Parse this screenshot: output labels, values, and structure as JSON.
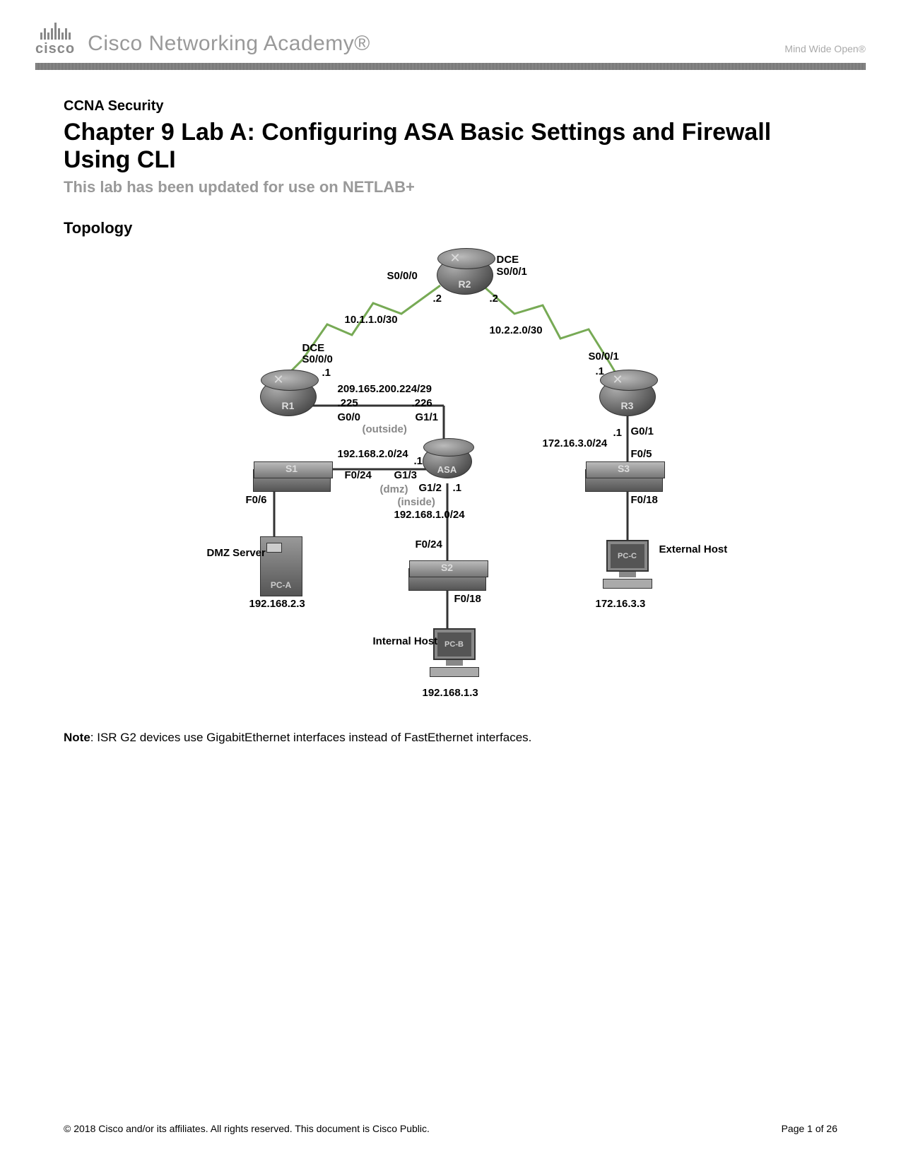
{
  "header": {
    "logo_text": "cisco",
    "academy": "Cisco Networking Academy®",
    "tagline": "Mind Wide Open®"
  },
  "course": "CCNA Security",
  "title": "Chapter 9 Lab A: Configuring ASA Basic Settings and Firewall Using CLI",
  "updated": "This lab has been updated for use on NETLAB+",
  "section": "Topology",
  "topology": {
    "devices": {
      "R1": "R1",
      "R2": "R2",
      "R3": "R3",
      "S1": "S1",
      "S2": "S2",
      "S3": "S3",
      "ASA": "ASA",
      "PCA": "PC-A",
      "PCB": "PC-B",
      "PCC": "PC-C"
    },
    "labels": {
      "dce1": "DCE",
      "r2_s000": "S0/0/0",
      "r2_s001": "S0/0/1",
      "r2_dot2a": ".2",
      "r2_dot2b": ".2",
      "net_10_1": "10.1.1.0/30",
      "net_10_2": "10.2.2.0/30",
      "r1_dce": "DCE",
      "r1_s000": "S0/0/0",
      "r1_dot1": ".1",
      "r3_s001": "S0/0/1",
      "r3_dot1": ".1",
      "net_209": "209.165.200.224/29",
      "dot225": ".225",
      "dot226": ".226",
      "g00": "G0/0",
      "g11": "G1/1",
      "outside": "(outside)",
      "net_172": "172.16.3.0/24",
      "r3_g01": "G0/1",
      "r3_dot1b": ".1",
      "s3_f05": "F0/5",
      "net_192_2": "192.168.2.0/24",
      "asa_dot1a": ".1",
      "s1_f024": "F0/24",
      "g13": "G1/3",
      "g12": "G1/2",
      "dmz": "(dmz)",
      "asa_dot1b": ".1",
      "inside": "(inside)",
      "net_192_1": "192.168.1.0/24",
      "s1_f06": "F0/6",
      "s3_f018": "F0/18",
      "s2_f024": "F0/24",
      "dmz_server": "DMZ Server",
      "pca_ip": "192.168.2.3",
      "s2_f018": "F0/18",
      "internal_host": "Internal Host",
      "pcb_ip": "192.168.1.3",
      "external_host": "External Host",
      "pcc_ip": "172.16.3.3"
    }
  },
  "note_label": "Note",
  "note_text": ": ISR G2 devices use GigabitEthernet interfaces instead of FastEthernet interfaces.",
  "footer": {
    "copyright": "© 2018 Cisco and/or its affiliates. All rights reserved. This document is Cisco Public.",
    "page": "Page 1 of 26"
  }
}
